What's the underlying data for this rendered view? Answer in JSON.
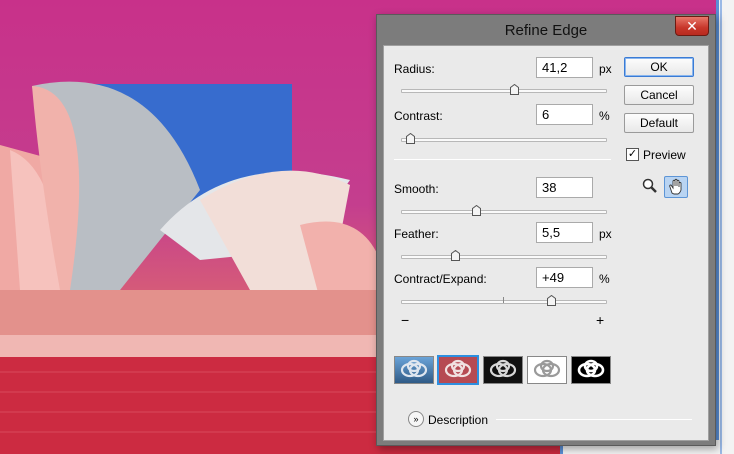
{
  "dialog": {
    "title": "Refine Edge",
    "close_label": "✕"
  },
  "sliders": {
    "radius": {
      "label": "Radius:",
      "value": "41,2",
      "unit": "px",
      "position_pct": 64
    },
    "contrast": {
      "label": "Contrast:",
      "value": "6",
      "unit": "%",
      "position_pct": 6
    },
    "smooth": {
      "label": "Smooth:",
      "value": "38",
      "position_pct": 38
    },
    "feather": {
      "label": "Feather:",
      "value": "5,5",
      "unit": "px",
      "position_pct": 28
    },
    "contract": {
      "label": "Contract/Expand:",
      "value": "+49",
      "unit": "%",
      "position_pct": 74,
      "minus": "−",
      "plus": "+"
    }
  },
  "buttons": {
    "ok": "OK",
    "cancel": "Cancel",
    "default": "Default"
  },
  "preview": {
    "label": "Preview",
    "checked": true,
    "check_glyph": "✓"
  },
  "tools": {
    "zoom": "zoom-icon",
    "hand": "hand-icon"
  },
  "view_modes": [
    "standard",
    "quick-mask",
    "on-black",
    "on-white",
    "black-and-white"
  ],
  "description": {
    "label": "Description",
    "chevron": "»"
  },
  "colors": {
    "accent": "#2d8fe0",
    "dialog_bg": "#eaeaea",
    "frame": "#7c7c7c",
    "close": "#c7362a"
  }
}
